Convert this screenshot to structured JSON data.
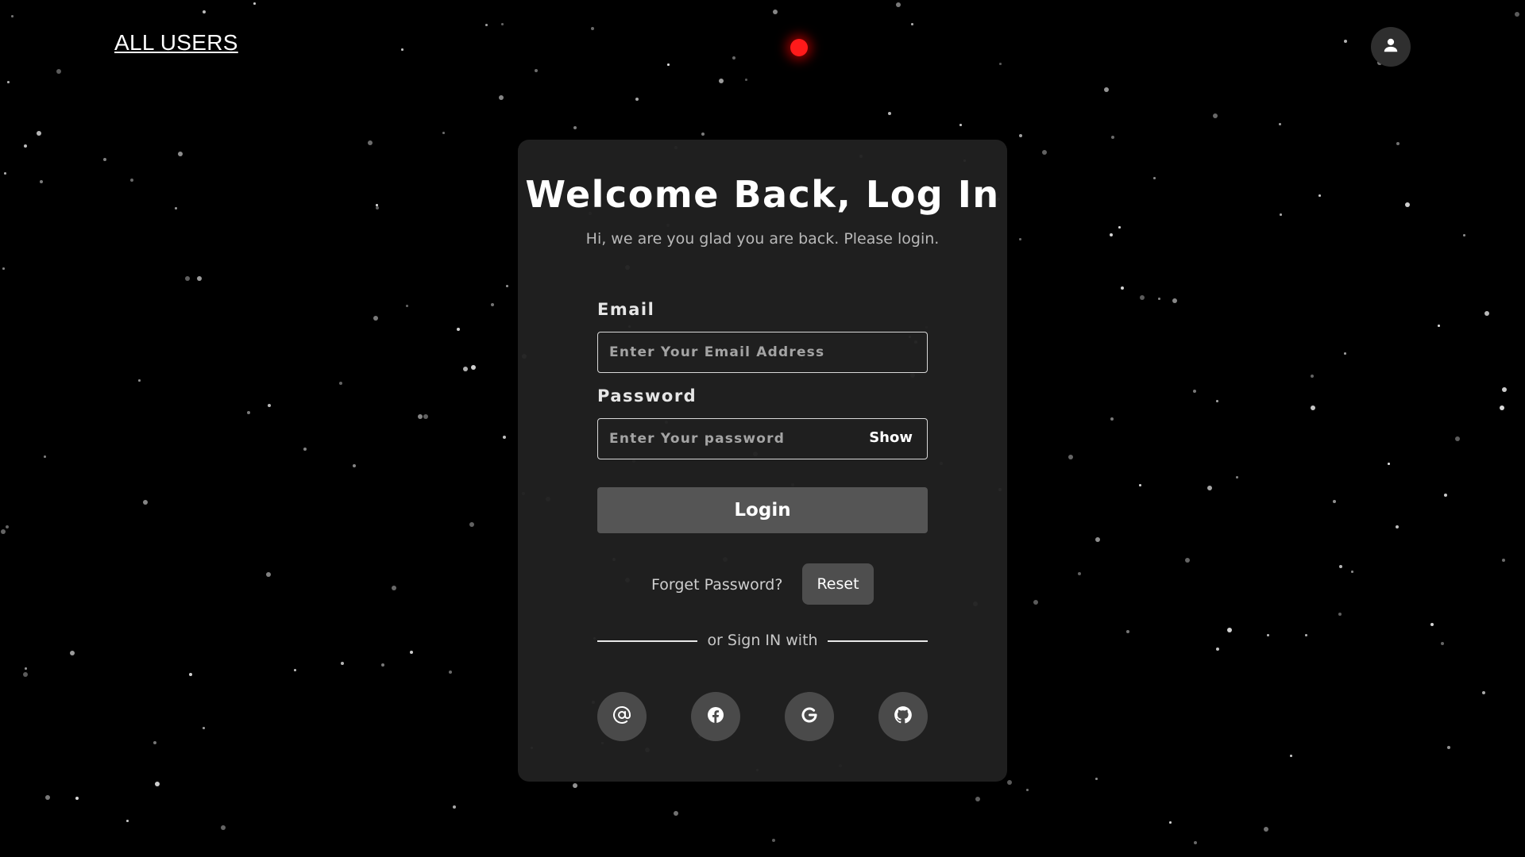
{
  "nav": {
    "all_users": "ALL USERS"
  },
  "header": {
    "avatar_icon": "user-icon",
    "status_dot_color": "#ff1a1a"
  },
  "login": {
    "title": "Welcome Back, Log In",
    "subtitle": "Hi, we are you glad you are back. Please login.",
    "email_label": "Email",
    "email_placeholder": "Enter Your Email Address",
    "email_value": "",
    "password_label": "Password",
    "password_placeholder": "Enter Your password",
    "password_value": "",
    "show_label": "Show",
    "login_label": "Login",
    "forgot_text": "Forget Password?",
    "reset_label": "Reset",
    "divider_text": "or Sign IN with",
    "social_icons": [
      "at-sign-icon",
      "facebook-icon",
      "google-icon",
      "github-icon"
    ]
  },
  "colors": {
    "background": "#000000",
    "card": "#202020",
    "button": "#555555"
  }
}
